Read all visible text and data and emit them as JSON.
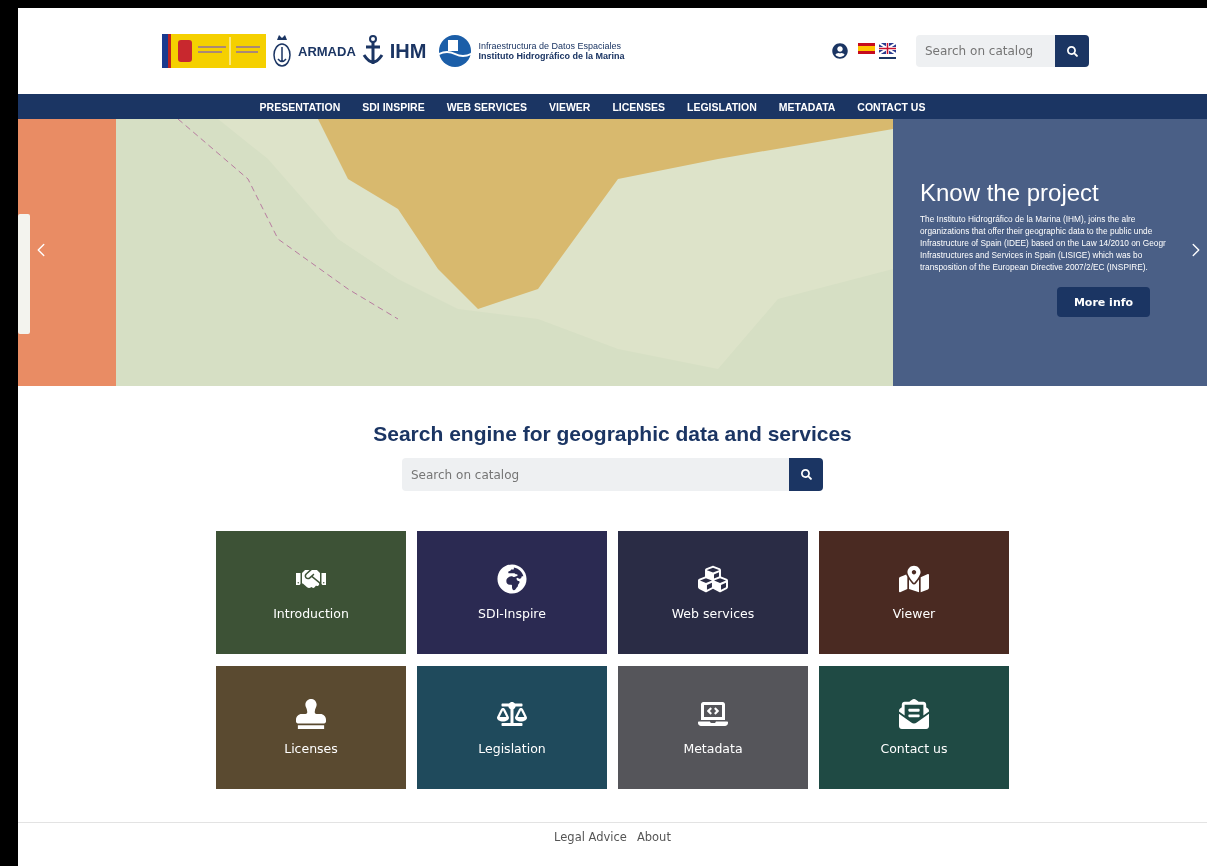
{
  "header": {
    "logos": {
      "armada": "ARMADA",
      "ihm": "IHM",
      "idem_line1": "Infraestructura de Datos Espaciales",
      "idem_line2": "Instituto Hidrográfico de la Marina"
    },
    "languages": [
      {
        "kind": "spanish",
        "selected": false
      },
      {
        "kind": "british",
        "selected": true
      }
    ],
    "search": {
      "placeholder": "Search on catalog"
    }
  },
  "nav": [
    "PRESENTATION",
    "SDI INSPIRE",
    "WEB SERVICES",
    "VIEWER",
    "LICENSES",
    "LEGISLATION",
    "METADATA",
    "CONTACT US"
  ],
  "hero": {
    "title": "Know the project",
    "lines": [
      "The Instituto Hidrográfico de la Marina (IHM), joins the alre",
      "organizations that offer their geographic data to the public unde",
      "Infrastructure of Spain (IDEE) based on the Law 14/2010 on Geogr",
      "Infrastructures and Services in Spain (LISIGE) which was bo",
      "transposition of the European Directive 2007/2/EC (INSPIRE)."
    ],
    "button": "More info"
  },
  "search_section": {
    "title": "Search engine for geographic data and services",
    "placeholder": "Search on catalog"
  },
  "tiles": [
    {
      "label": "Introduction",
      "color": "#3d5236"
    },
    {
      "label": "SDI-Inspire",
      "color": "#2b2a52"
    },
    {
      "label": "Web services",
      "color": "#2a2c45"
    },
    {
      "label": "Viewer",
      "color": "#4a2a22"
    },
    {
      "label": "Licenses",
      "color": "#5a4a30"
    },
    {
      "label": "Legislation",
      "color": "#1f4a5c"
    },
    {
      "label": "Metadata",
      "color": "#55555a"
    },
    {
      "label": "Contact us",
      "color": "#1f4a44"
    }
  ],
  "footer": [
    "Legal Advice",
    "About"
  ]
}
